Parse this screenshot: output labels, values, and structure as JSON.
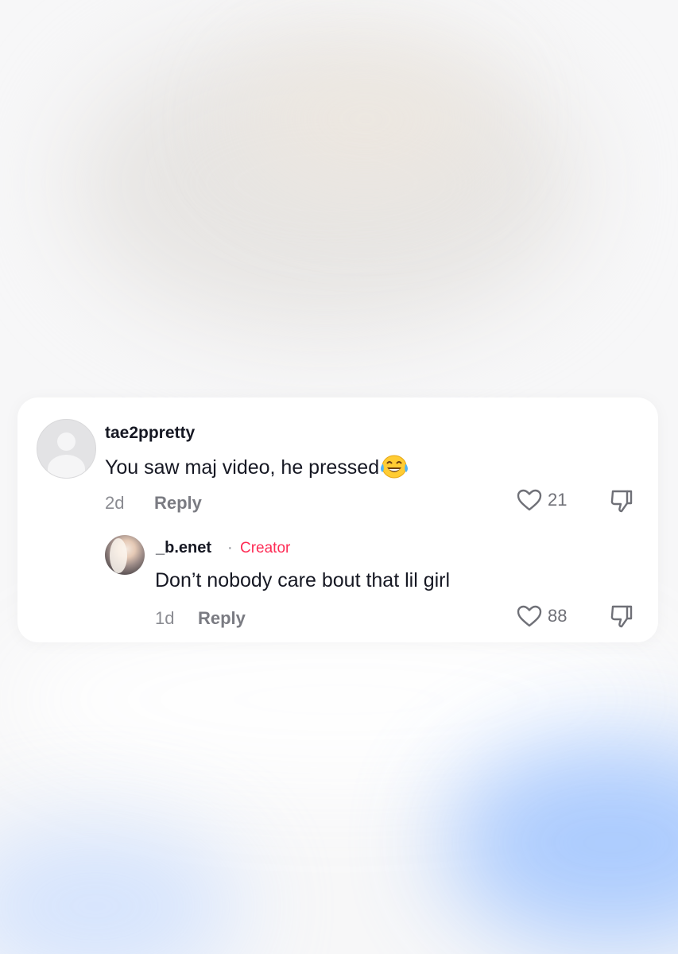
{
  "colors": {
    "text_primary": "#161823",
    "text_secondary": "#8a8b91",
    "creator_accent": "#fe2c55",
    "card_background": "#ffffff"
  },
  "comments": [
    {
      "username": "tae2ppretty",
      "text": "You saw maj video, he pressed",
      "emoji": "face-with-tears-of-joy",
      "time": "2d",
      "reply_label": "Reply",
      "likes": "21",
      "avatar": "default-avatar-icon"
    }
  ],
  "replies": [
    {
      "username": "_b.enet",
      "separator": "·",
      "badge": "Creator",
      "text": "Don’t nobody care bout that lil girl",
      "time": "1d",
      "reply_label": "Reply",
      "likes": "88",
      "avatar": "profile-photo"
    }
  ]
}
